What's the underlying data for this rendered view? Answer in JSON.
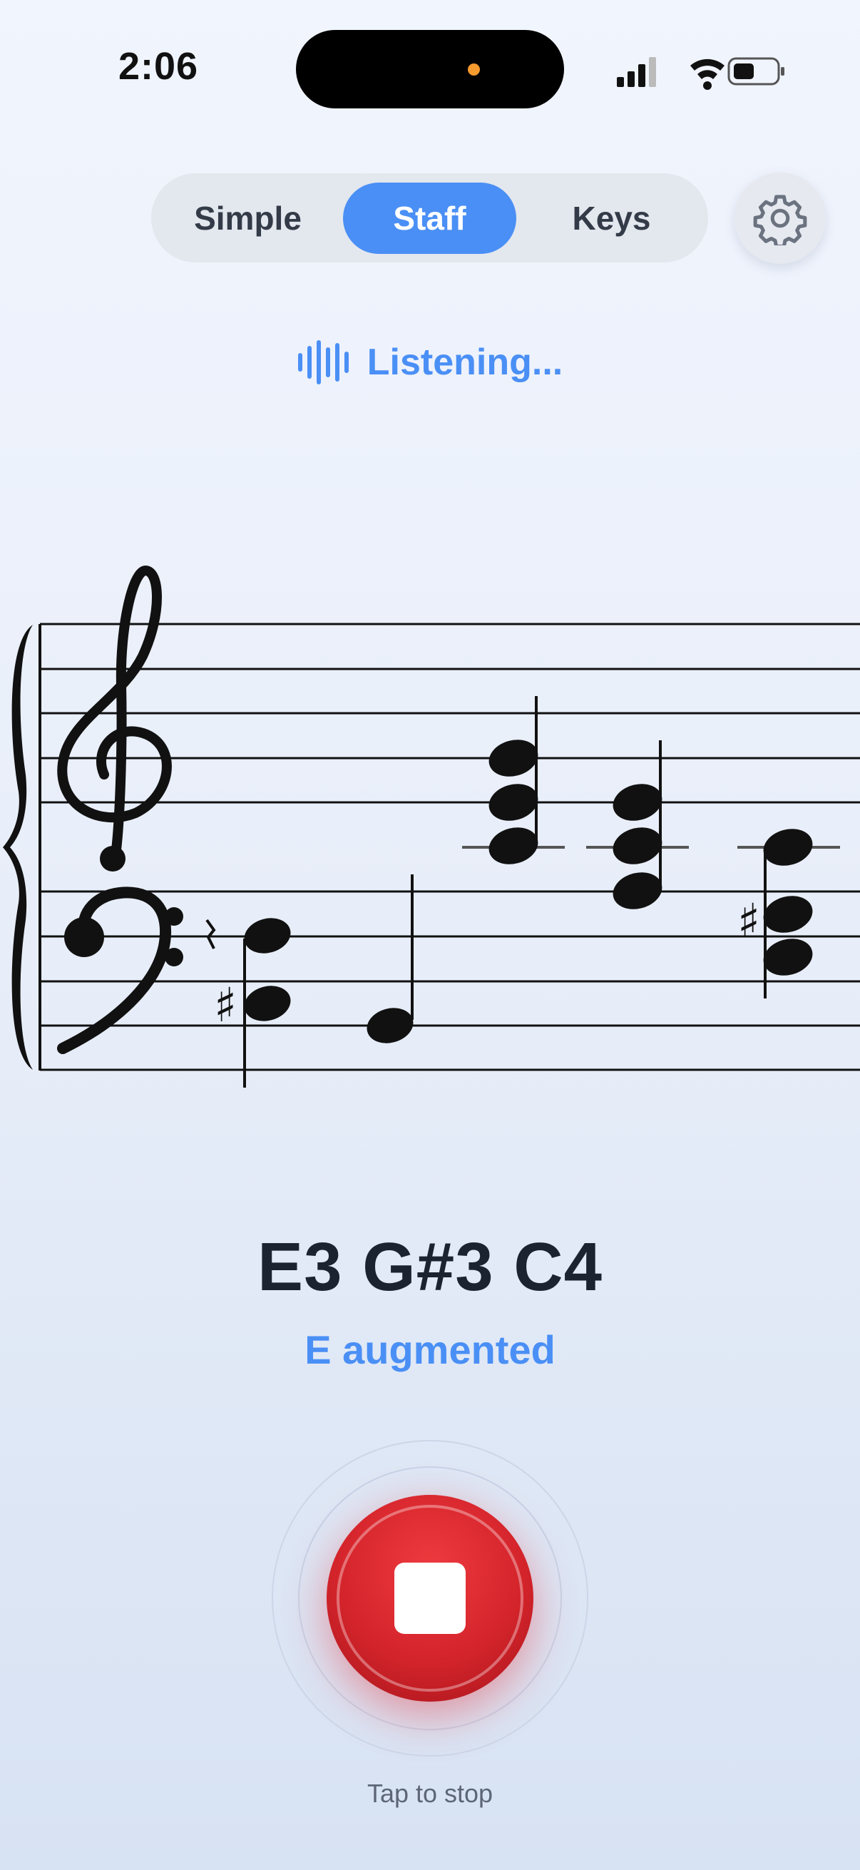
{
  "status_bar": {
    "time": "2:06"
  },
  "mode_selector": {
    "items": [
      {
        "label": "Simple",
        "active": false
      },
      {
        "label": "Staff",
        "active": true
      },
      {
        "label": "Keys",
        "active": false
      }
    ]
  },
  "settings": {
    "icon": "gear-icon"
  },
  "listening": {
    "label": "Listening...",
    "icon": "waveform-icon"
  },
  "detection": {
    "notes": "E3 G#3 C4",
    "chord": "E augmented"
  },
  "record": {
    "hint": "Tap to stop",
    "icon": "stop-icon"
  },
  "colors": {
    "accent": "#4a8ff5",
    "stop": "#d4242b"
  }
}
